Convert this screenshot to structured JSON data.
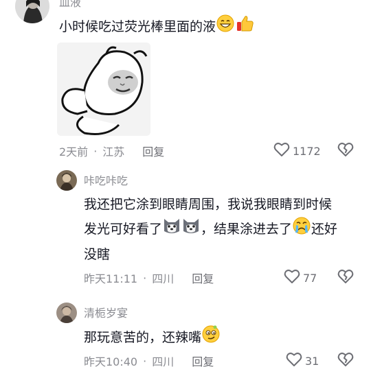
{
  "comments": [
    {
      "username": "皿液",
      "text": "小时候吃过荧光棒里面的液",
      "date": "2天前",
      "location": "江苏",
      "reply_label": "回复",
      "likes": "1172"
    },
    {
      "username": "咔吃咔吃",
      "text_line1": "我还把它涂到眼睛周围，我说我眼睛到时候",
      "text_line2a": "发光可好看了",
      "text_line2b": "，结果涂进去了",
      "text_line2c": "还好",
      "text_line3": "没瞎",
      "date": "昨天11:11",
      "location": "四川",
      "reply_label": "回复",
      "likes": "77"
    },
    {
      "username": "清栀岁宴",
      "text": "那玩意苦的，还辣嘴",
      "date": "昨天10:40",
      "location": "四川",
      "reply_label": "回复",
      "likes": "31"
    }
  ],
  "meta_separator": "·",
  "icons": {
    "like": "heart-outline-icon",
    "dislike": "broken-heart-icon",
    "emoji_grin": "grinning-emoji",
    "emoji_thumb": "thumbs-up-emoji",
    "emoji_husky": "husky-emoji",
    "emoji_cry": "crying-emoji",
    "emoji_smirk": "smirk-emoji"
  },
  "colors": {
    "text": "#161823",
    "secondary": "#8a8b91",
    "background": "#ffffff"
  }
}
